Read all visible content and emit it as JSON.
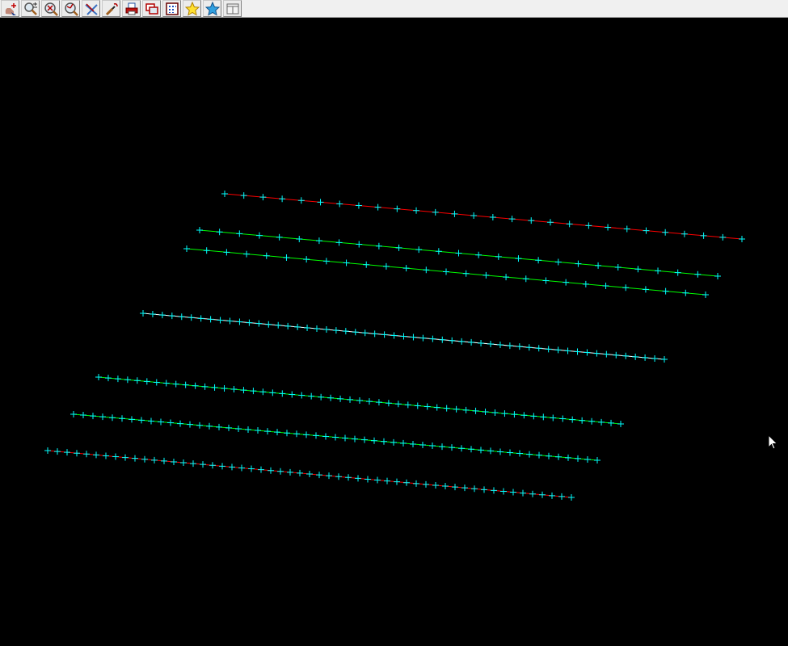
{
  "toolbar": {
    "buttons": [
      {
        "name": "pan-button",
        "icon": "pan-hand-icon"
      },
      {
        "name": "zoom-in-out-button",
        "icon": "zoom-in-out-icon"
      },
      {
        "name": "zoom-extents-button",
        "icon": "zoom-extents-icon"
      },
      {
        "name": "zoom-previous-button",
        "icon": "zoom-previous-icon"
      },
      {
        "name": "clear-selection-button",
        "icon": "clear-selection-icon"
      },
      {
        "name": "pick-button",
        "icon": "brush-icon"
      },
      {
        "name": "print-button",
        "icon": "printer-icon"
      },
      {
        "name": "copy-button",
        "icon": "copy-windows-icon"
      },
      {
        "name": "grid-button",
        "icon": "grid-icon"
      },
      {
        "name": "favorite-yellow-button",
        "icon": "star-yellow-icon"
      },
      {
        "name": "favorite-blue-button",
        "icon": "star-blue-icon"
      },
      {
        "name": "window-button",
        "icon": "window-layout-icon"
      }
    ]
  },
  "plot": {
    "background": "#000000",
    "marker_color": "#00ffff",
    "lines": [
      {
        "color": "#ff0000",
        "markers": 28
      },
      {
        "color": "#00ff00",
        "markers": 27
      },
      {
        "color": "#00ff00",
        "markers": 27
      },
      {
        "color": "#ffffff",
        "markers": 55
      },
      {
        "color": "#00ff00",
        "markers": 55
      },
      {
        "color": "#00ff00",
        "markers": 55
      },
      {
        "color": "#ff0000",
        "markers": 55
      }
    ]
  }
}
